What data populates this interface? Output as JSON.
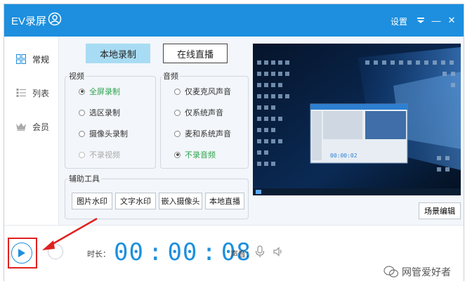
{
  "titlebar": {
    "app_name": "EV录屏",
    "settings_label": "设置",
    "menu_icon": "dropdown-menu-icon",
    "minimize_symbol": "—",
    "close_symbol": "✕"
  },
  "sidebar": {
    "items": [
      {
        "label": "常规",
        "icon": "grid-icon"
      },
      {
        "label": "列表",
        "icon": "list-icon"
      },
      {
        "label": "会员",
        "icon": "crown-icon"
      }
    ]
  },
  "mode_buttons": {
    "local": "本地录制",
    "live": "在线直播"
  },
  "video": {
    "title": "视频",
    "options": [
      "全屏录制",
      "选区录制",
      "摄像头录制",
      "不录视频"
    ],
    "selected": "全屏录制"
  },
  "audio": {
    "title": "音频",
    "options": [
      "仅麦克风声音",
      "仅系统声音",
      "麦和系统声音",
      "不录音频"
    ],
    "selected": "不录音频"
  },
  "tools": {
    "title": "辅助工具",
    "buttons": [
      "图片水印",
      "文字水印",
      "嵌入摄像头",
      "本地直播"
    ]
  },
  "preview": {
    "mini_timer": "00:00:02"
  },
  "scene_edit_label": "场景编辑",
  "bottom": {
    "duration_label": "时长：",
    "timer": {
      "h": "00",
      "m": "00",
      "s": "08"
    },
    "audio_label": "声音："
  },
  "watermark_text": "网管爱好者",
  "colors": {
    "accent": "#1d8fde",
    "highlight_box": "#e02020",
    "selected_green": "#2ea44f"
  }
}
